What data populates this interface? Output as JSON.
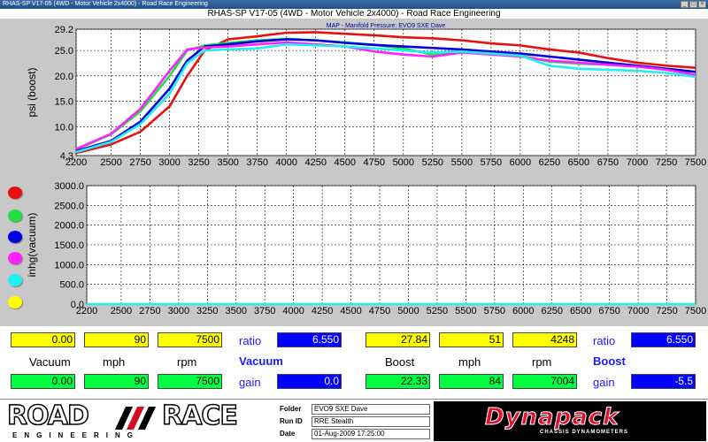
{
  "window": {
    "caption": "RHAS-SP V17-05   (4WD - Motor Vehicle 2x4000) - Road Race Engineering",
    "app_title": "RHAS-SP V17-05   (4WD - Motor Vehicle 2x4000) - Road Race Engineering",
    "btn_min": "_",
    "btn_max": "□",
    "btn_close": "×"
  },
  "colors": {
    "red": "#e81010",
    "green": "#20e040",
    "blue": "#0000e0",
    "magenta": "#ff20ff",
    "cyan": "#20f0f0",
    "yellow": "#ffff00"
  },
  "legend": {
    "series_colors": [
      "#e81010",
      "#20e040",
      "#0000e0",
      "#ff20ff",
      "#20f0f0",
      "#ffff00"
    ]
  },
  "chart_data": [
    {
      "type": "line",
      "title": "MAP - Manifold Pressure: EVO9 SXE Dave",
      "xlabel": "",
      "ylabel": "psi (boost)",
      "xlim": [
        2200,
        7500
      ],
      "ylim": [
        4.3,
        29.2
      ],
      "x_ticks": [
        2200,
        2500,
        2750,
        3000,
        3250,
        3500,
        3750,
        4000,
        4250,
        4500,
        4750,
        5000,
        5250,
        5500,
        5750,
        6000,
        6250,
        6500,
        6750,
        7000,
        7250,
        7500
      ],
      "y_ticks": [
        4.3,
        10.0,
        15.0,
        20.0,
        25.0,
        29.2
      ],
      "y_tick_labels": [
        "4.3",
        "10.0",
        "15.0",
        "20.0",
        "25.0",
        "29.2"
      ],
      "grid": true,
      "series": [
        {
          "color": "#e81010",
          "x": [
            2200,
            2500,
            2750,
            3000,
            3150,
            3300,
            3500,
            3750,
            4000,
            4250,
            4500,
            4750,
            5000,
            5250,
            5500,
            5750,
            6000,
            6250,
            6500,
            6750,
            7000,
            7250,
            7500
          ],
          "y": [
            4.8,
            6.5,
            9.0,
            14.0,
            20.0,
            25.0,
            27.2,
            27.8,
            28.5,
            28.6,
            28.3,
            28.0,
            27.6,
            27.4,
            27.0,
            26.4,
            26.0,
            25.2,
            24.6,
            23.5,
            22.6,
            22.0,
            21.6
          ]
        },
        {
          "color": "#20e040",
          "x": [
            2200,
            2500,
            2750,
            3000,
            3150,
            3300,
            3500,
            3750,
            4000,
            4250,
            4500,
            4750,
            5000,
            5250,
            5500,
            5750,
            6000,
            6250,
            6500,
            6750,
            7000,
            7250,
            7500
          ],
          "y": [
            5.5,
            8.5,
            13.0,
            20.0,
            25.0,
            26.0,
            26.5,
            27.0,
            27.3,
            27.0,
            26.6,
            26.1,
            25.4,
            24.2,
            25.0,
            24.6,
            24.0,
            22.8,
            22.4,
            22.2,
            22.0,
            21.4,
            20.8
          ]
        },
        {
          "color": "#0000e0",
          "x": [
            2200,
            2500,
            2750,
            3000,
            3150,
            3300,
            3500,
            3750,
            4000,
            4250,
            4500,
            4750,
            5000,
            5250,
            5500,
            5750,
            6000,
            6250,
            6500,
            6750,
            7000,
            7250,
            7500
          ],
          "y": [
            5.2,
            7.2,
            11.0,
            17.5,
            23.0,
            25.8,
            26.2,
            26.8,
            27.2,
            27.0,
            26.5,
            26.1,
            25.8,
            25.5,
            25.2,
            24.8,
            24.4,
            23.8,
            23.2,
            22.6,
            22.0,
            21.4,
            20.8
          ]
        },
        {
          "color": "#ff20ff",
          "x": [
            2200,
            2500,
            2750,
            3000,
            3150,
            3300,
            3500,
            3750,
            4000,
            4250,
            4500,
            4750,
            5000,
            5250,
            5500,
            5750,
            6000,
            6250,
            6500,
            6750,
            7000,
            7250,
            7500
          ],
          "y": [
            5.6,
            8.6,
            13.5,
            21.0,
            25.2,
            25.6,
            25.8,
            26.2,
            26.6,
            26.2,
            25.8,
            24.8,
            24.2,
            23.8,
            24.6,
            24.2,
            23.8,
            23.0,
            22.6,
            22.2,
            21.8,
            21.2,
            20.2
          ]
        },
        {
          "color": "#20f0f0",
          "x": [
            2200,
            2500,
            2750,
            3000,
            3150,
            3300,
            3500,
            3750,
            4000,
            4250,
            4500,
            4750,
            5000,
            5250,
            5500,
            5750,
            6000,
            6250,
            6500,
            6750,
            7000,
            7250,
            7500
          ],
          "y": [
            5.0,
            7.0,
            10.5,
            16.5,
            22.5,
            25.0,
            25.2,
            25.4,
            26.2,
            26.0,
            25.8,
            25.4,
            25.0,
            24.6,
            24.8,
            24.4,
            24.0,
            22.0,
            21.4,
            21.2,
            21.0,
            20.6,
            19.8
          ]
        }
      ]
    },
    {
      "type": "line",
      "title": "",
      "xlabel": "",
      "ylabel": "inhg(vacuum)",
      "xlim": [
        2200,
        7500
      ],
      "ylim": [
        0,
        3000
      ],
      "x_ticks": [
        2200,
        2500,
        2750,
        3000,
        3250,
        3500,
        3750,
        4000,
        4250,
        4500,
        4750,
        5000,
        5250,
        5500,
        5750,
        6000,
        6250,
        6500,
        6750,
        7000,
        7250,
        7500
      ],
      "y_ticks": [
        0,
        500,
        1000,
        1500,
        2000,
        2500,
        3000
      ],
      "y_tick_labels": [
        "0.0",
        "500.0",
        "1000.0",
        "1500.0",
        "2000.0",
        "2500.0",
        "3000.0"
      ],
      "grid": true,
      "series": [
        {
          "color": "#20f0f0",
          "x": [
            2200,
            7500
          ],
          "y": [
            0,
            0
          ]
        }
      ]
    }
  ],
  "readouts": {
    "vacuum": {
      "heading": "Vacuum",
      "cursor": {
        "vacuum": "0.00",
        "mph": "90",
        "rpm": "7500"
      },
      "labels": {
        "vacuum": "Vacuum",
        "mph": "mph",
        "rpm": "rpm"
      },
      "values": {
        "vacuum": "0.00",
        "mph": "90",
        "rpm": "7500"
      },
      "ratio_label": "ratio",
      "ratio": "6.550",
      "gain_label": "gain",
      "gain": "0.0"
    },
    "boost": {
      "heading": "Boost",
      "cursor": {
        "boost": "27.84",
        "mph": "51",
        "rpm": "4248"
      },
      "labels": {
        "boost": "Boost",
        "mph": "mph",
        "rpm": "rpm"
      },
      "values": {
        "boost": "22.33",
        "mph": "84",
        "rpm": "7004"
      },
      "ratio_label": "ratio",
      "ratio": "6.550",
      "gain_label": "gain",
      "gain": "-5.5"
    }
  },
  "footer": {
    "logo_road": "ROAD",
    "logo_race": "RACE",
    "logo_sub": "ENGINEERING",
    "folder_label": "Folder",
    "folder": "EVO9 SXE Dave",
    "runid_label": "Run ID",
    "runid": "RRE Stealth",
    "date_label": "Date",
    "date": "01-Aug-2009   17:25:00",
    "dyna_logo": "Dynapack",
    "dyna_sub": "CHASSIS DYNAMOMETERS"
  }
}
